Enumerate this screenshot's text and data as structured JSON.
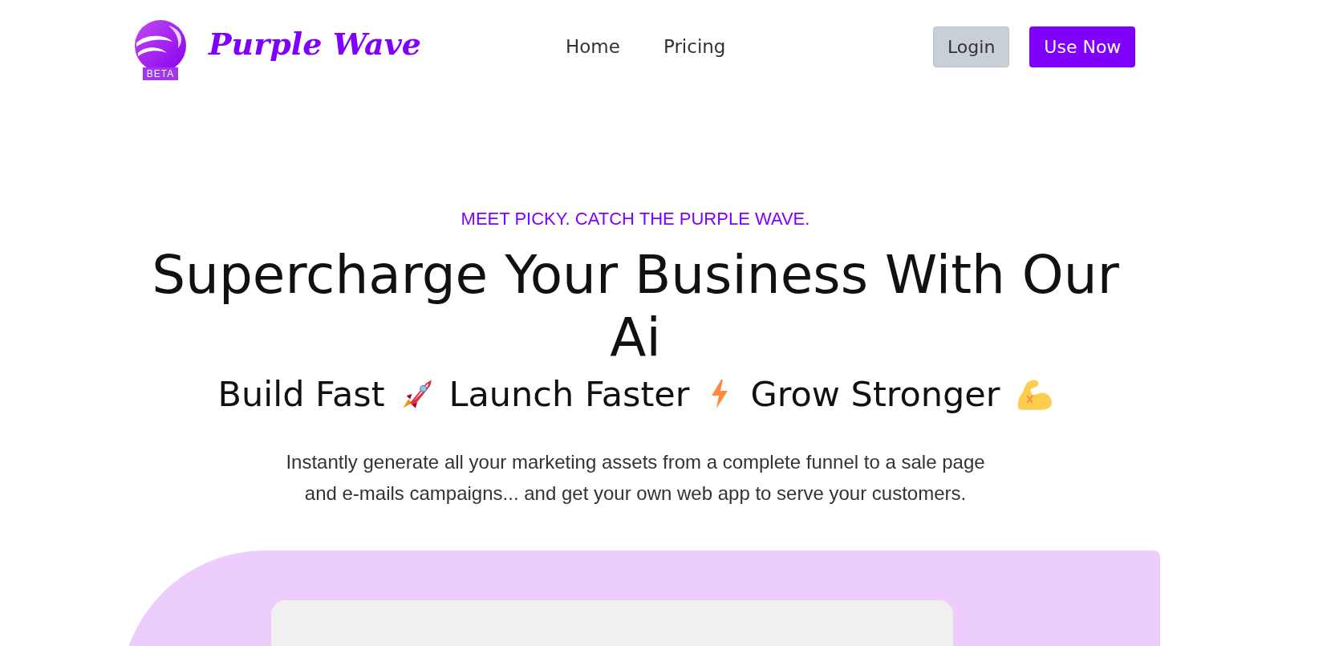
{
  "brand": {
    "name": "Purple Wave",
    "badge": "BETA"
  },
  "nav": [
    {
      "label": "Home"
    },
    {
      "label": "Pricing"
    }
  ],
  "actions": [
    {
      "label": "Login",
      "kind": "secondary"
    },
    {
      "label": "Use Now",
      "kind": "primary"
    }
  ],
  "hero": {
    "eyebrow": "MEET PICKY. CATCH THE PURPLE WAVE.",
    "title": "Supercharge Your Business With Our Ai",
    "tagline": [
      {
        "text": "Build Fast",
        "kind": "rocket"
      },
      {
        "text": "Launch Faster",
        "kind": "bolt"
      },
      {
        "text": "Grow Stronger",
        "kind": "arm"
      }
    ],
    "description": "Instantly generate all your marketing assets from a complete funnel to a sale page and e-mails campaigns... and get your own web app to serve your customers."
  }
}
